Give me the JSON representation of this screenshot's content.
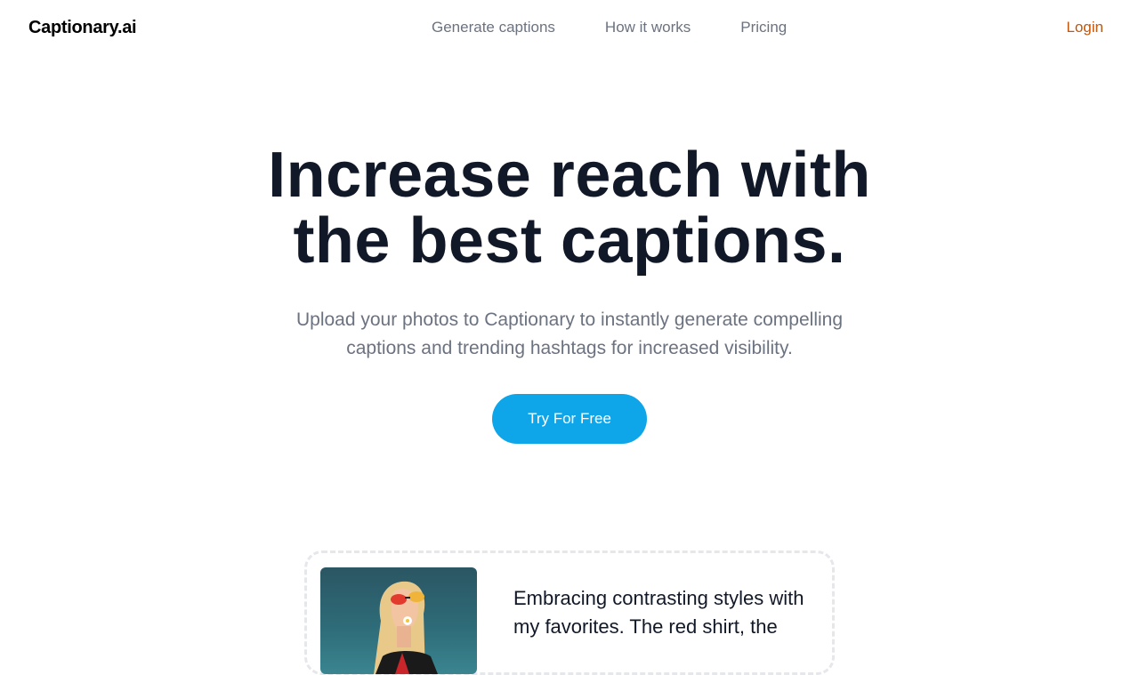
{
  "brand": {
    "name": "Captionary.ai"
  },
  "nav": {
    "links": [
      {
        "label": "Generate captions"
      },
      {
        "label": "How it works"
      },
      {
        "label": "Pricing"
      }
    ],
    "login_label": "Login"
  },
  "hero": {
    "title_lines": [
      "Increase reach with",
      "the best captions."
    ],
    "subtitle_lines": [
      "Upload your photos to Captionary to instantly generate compelling",
      "captions and trending hashtags for increased visibility."
    ],
    "cta_label": "Try For Free"
  },
  "example": {
    "caption_lines": [
      "Embracing contrasting styles with",
      "my favorites. The red shirt, the"
    ]
  },
  "colors": {
    "accent": "#0ea5e9",
    "login": "#c2570c",
    "heading": "#111827",
    "muted": "#6b7280"
  }
}
